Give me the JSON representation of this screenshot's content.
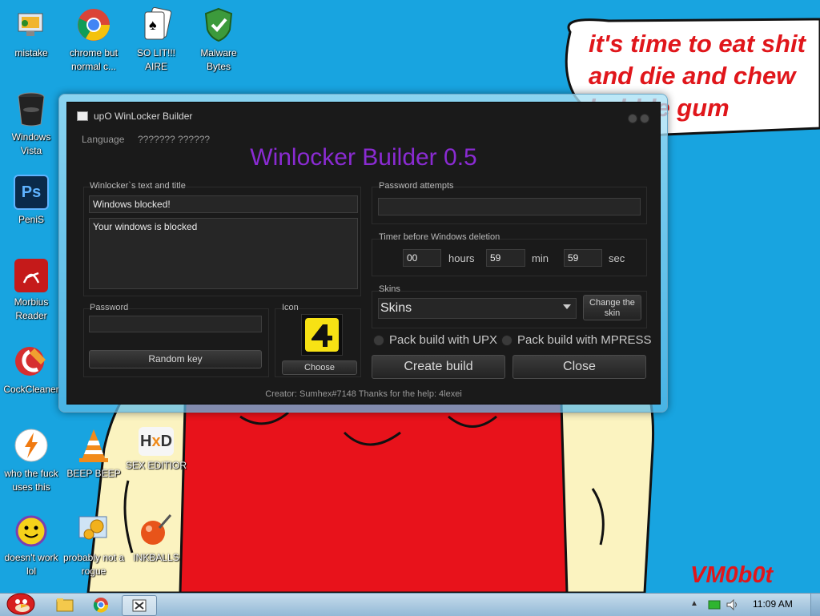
{
  "wallpaper": {
    "speech_lines": [
      "it's time to eat shit",
      "and die and chew",
      "bubble gum"
    ],
    "signature": "VM0b0t",
    "background_color": "#18a4e0"
  },
  "desktop_icons": [
    {
      "label": "mistake",
      "icon": "computer-icon"
    },
    {
      "label": "chrome but normal c...",
      "icon": "chrome-icon"
    },
    {
      "label": "SO LIT!!! AIRE",
      "icon": "cards-icon"
    },
    {
      "label": "Malware Bytes",
      "icon": "shield-icon"
    },
    {
      "label": "Windows Vista",
      "icon": "recycle-bin-icon"
    },
    {
      "label": "PeniS",
      "icon": "photoshop-icon"
    },
    {
      "label": "Morbius Reader",
      "icon": "pdf-icon"
    },
    {
      "label": "CockCleaner",
      "icon": "broom-icon"
    },
    {
      "label": "who the fuck uses this",
      "icon": "lightning-icon"
    },
    {
      "label": "BEEP BEEP",
      "icon": "cone-icon"
    },
    {
      "label": "SEX EDITIOR",
      "icon": "hex-editor-icon"
    },
    {
      "label": "doesn't work lol",
      "icon": "yahoo-icon"
    },
    {
      "label": "probably not a rogue",
      "icon": "gears-icon"
    },
    {
      "label": "INKBALLS",
      "icon": "inkball-icon"
    }
  ],
  "window": {
    "title": "upO WinLocker Builder",
    "language_label": "Language",
    "language_value": "??????? ??????",
    "heading": "Winlocker Builder 0.5",
    "text_group": {
      "label": "Winlocker`s text and title",
      "title_value": "Windows blocked!",
      "body_value": "Your windows is blocked"
    },
    "password_group": {
      "label": "Password",
      "value": "",
      "random_key_button": "Random key"
    },
    "icon_group": {
      "label": "Icon",
      "choose_button": "Choose"
    },
    "password_attempts_group": {
      "label": "Password attempts",
      "value": ""
    },
    "timer_group": {
      "label": "Timer before Windows deletion",
      "hours_value": "00",
      "hours_unit": "hours",
      "min_value": "59",
      "min_unit": "min",
      "sec_value": "59",
      "sec_unit": "sec"
    },
    "skins_group": {
      "label": "Skins",
      "selected": "Skins",
      "change_button": "Change the skin"
    },
    "pack_upx": "Pack build with UPX",
    "pack_mpress": "Pack build with MPRESS",
    "create_button": "Create build",
    "close_button": "Close",
    "footer": "Creator: Sumhex#7148 Thanks for the help: 4lexei"
  },
  "taskbar": {
    "clock": "11:09 AM"
  },
  "colors": {
    "heading_purple": "#8a2bd2",
    "speech_red": "#e0161b"
  }
}
